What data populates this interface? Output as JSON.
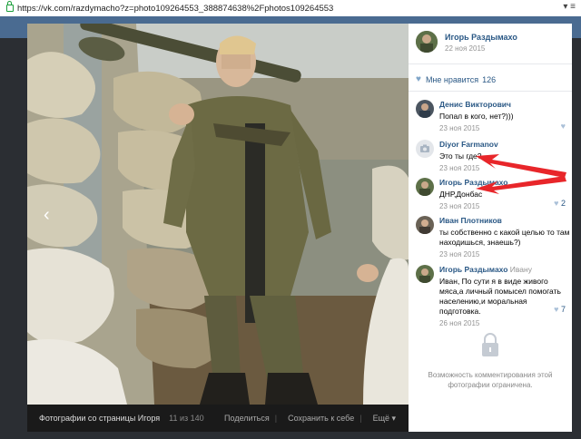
{
  "browser": {
    "url": "https://vk.com/razdymacho?z=photo109264553_388874638%2Fphotos109264553",
    "menu_glyph": "▾ ≡"
  },
  "viewer": {
    "prev_glyph": "‹",
    "footer": {
      "title": "Фотографии со страницы Игоря",
      "count": "11 из 140",
      "share": "Поделиться",
      "save": "Сохранить к себе",
      "more": "Ещё ▾"
    }
  },
  "author": {
    "name": "Игорь Раздымахо",
    "date": "22 ноя 2015"
  },
  "likes": {
    "label": "Мне нравится",
    "count": "126"
  },
  "comments": [
    {
      "name": "Денис Викторович",
      "reply_to": "",
      "text": "Попал в кого, нет?)))",
      "date": "23 ноя 2015",
      "likes": ""
    },
    {
      "name": "Diyor Farmanov",
      "reply_to": "",
      "text": "Это ты где?",
      "date": "23 ноя 2015",
      "likes": ""
    },
    {
      "name": "Игорь Раздымахо",
      "reply_to": "",
      "text": "ДНР,Донбас",
      "date": "23 ноя 2015",
      "likes": "2"
    },
    {
      "name": "Иван Плотников",
      "reply_to": "",
      "text": "ты собственно с какой целью то там находишься, знаешь?)",
      "date": "23 ноя 2015",
      "likes": ""
    },
    {
      "name": "Игорь Раздымахо",
      "reply_to": "Ивану",
      "text": "Иван, По сути я в виде живого мяса,а личный помысел помогать населению,и моральная подготовка.",
      "date": "26 ноя 2015",
      "likes": "7"
    }
  ],
  "restricted": {
    "text": "Возможность комментирования этой фотографии ограничена."
  },
  "colors": {
    "link": "#2a5885",
    "vk_blue": "#4a6b91",
    "arrow": "#e8262a"
  }
}
